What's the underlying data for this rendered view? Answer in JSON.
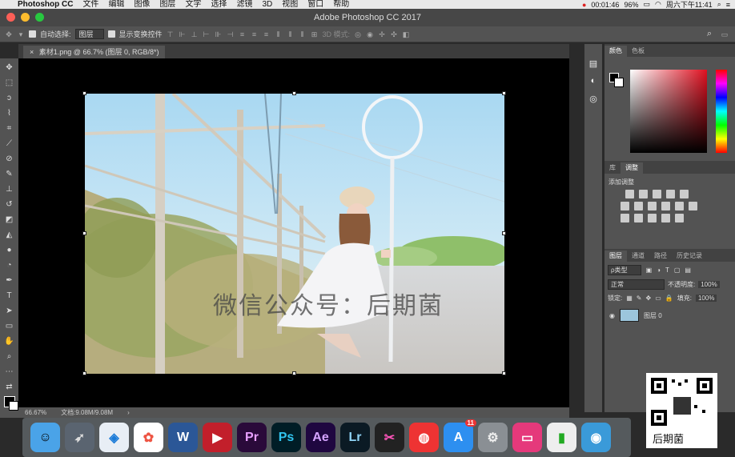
{
  "menubar": {
    "app_name": "Photoshop CC",
    "items": [
      "文件",
      "编辑",
      "图像",
      "图层",
      "文字",
      "选择",
      "滤镜",
      "3D",
      "视图",
      "窗口",
      "帮助"
    ],
    "timer": "00:01:46",
    "battery": "96%",
    "clock": "周六下午11:41"
  },
  "window": {
    "title": "Adobe Photoshop CC 2017"
  },
  "options": {
    "auto_select_label": "自动选择:",
    "auto_select_value": "图层",
    "transform_label": "显示变换控件",
    "mode_3d": "3D 模式:"
  },
  "document": {
    "tab_title": "素材1.png @ 66.7% (图层 0, RGB/8*)",
    "watermark": "微信公众号：后期菌",
    "zoom": "66.67%",
    "doc_size": "文档:9.08M/9.08M"
  },
  "panels": {
    "color_tabs": [
      "颜色",
      "色板"
    ],
    "lib_tabs": [
      "库",
      "调整"
    ],
    "add_adjustment": "添加调整",
    "layer_tabs": [
      "图层",
      "通道",
      "路径",
      "历史记录"
    ],
    "kind_filter": "ρ类型",
    "blend_mode": "正常",
    "opacity_label": "不透明度:",
    "opacity_value": "100%",
    "lock_label": "锁定:",
    "fill_label": "填充:",
    "fill_value": "100%",
    "layer_name": "图层 0"
  },
  "dock": {
    "apps": [
      {
        "name": "Pr",
        "color": "#2a0a3a",
        "fg": "#e9a0ff"
      },
      {
        "name": "Ps",
        "color": "#001d26",
        "fg": "#31c5f0"
      },
      {
        "name": "Ae",
        "color": "#1f0740",
        "fg": "#d5a4ff"
      },
      {
        "name": "Lr",
        "color": "#0b1a24",
        "fg": "#8fd3f5"
      }
    ],
    "badge": "11"
  },
  "qr_label": "后期菌"
}
